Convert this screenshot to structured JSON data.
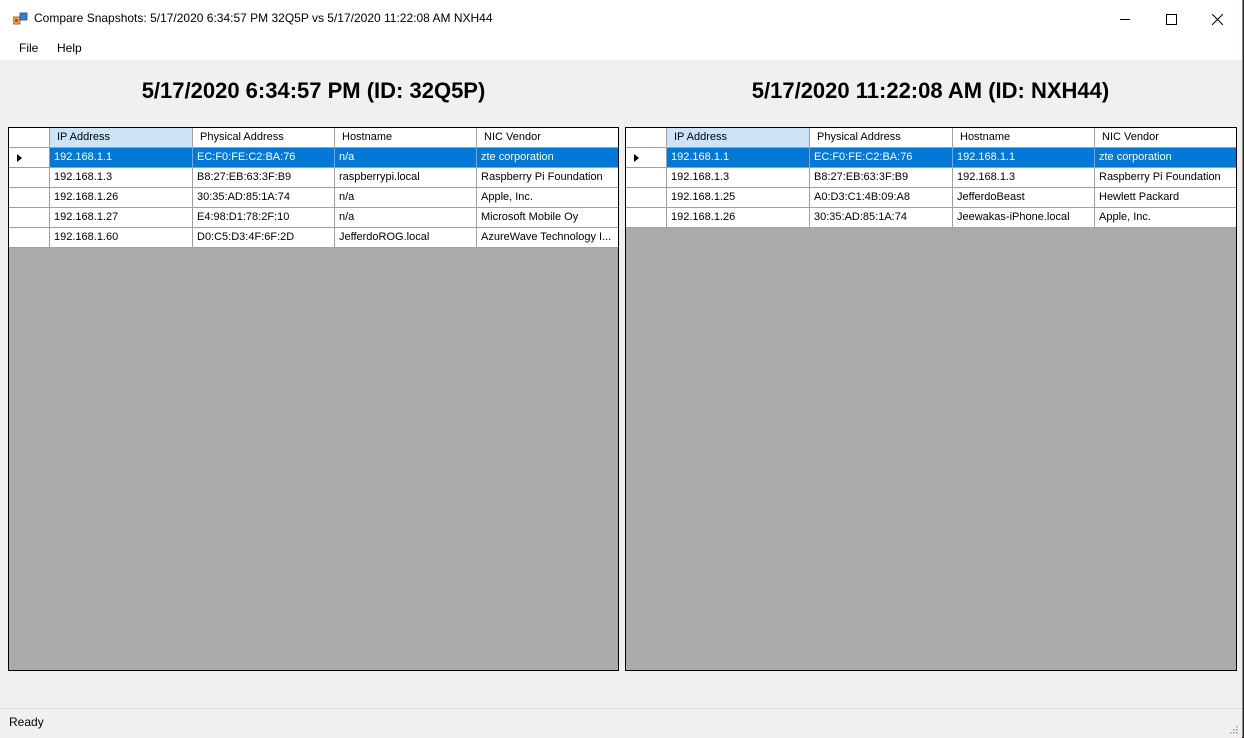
{
  "window": {
    "title": "Compare Snapshots: 5/17/2020 6:34:57 PM 32Q5P vs 5/17/2020 11:22:08 AM NXH44",
    "minimize_icon": "minimize-icon",
    "maximize_icon": "maximize-icon",
    "close_icon": "close-icon"
  },
  "menu": {
    "file": "File",
    "help": "Help"
  },
  "left": {
    "title": "5/17/2020 6:34:57 PM (ID: 32Q5P)",
    "columns": [
      "IP Address",
      "Physical Address",
      "Hostname",
      "NIC Vendor"
    ],
    "rows": [
      [
        "192.168.1.1",
        "EC:F0:FE:C2:BA:76",
        "n/a",
        "zte corporation"
      ],
      [
        "192.168.1.3",
        "B8:27:EB:63:3F:B9",
        "raspberrypi.local",
        "Raspberry Pi Foundation"
      ],
      [
        "192.168.1.26",
        "30:35:AD:85:1A:74",
        "n/a",
        "Apple, Inc."
      ],
      [
        "192.168.1.27",
        "E4:98:D1:78:2F:10",
        "n/a",
        "Microsoft Mobile Oy"
      ],
      [
        "192.168.1.60",
        "D0:C5:D3:4F:6F:2D",
        "JefferdoROG.local",
        "AzureWave Technology I..."
      ]
    ]
  },
  "right": {
    "title": "5/17/2020 11:22:08 AM (ID: NXH44)",
    "columns": [
      "IP Address",
      "Physical Address",
      "Hostname",
      "NIC Vendor"
    ],
    "rows": [
      [
        "192.168.1.1",
        "EC:F0:FE:C2:BA:76",
        "192.168.1.1",
        "zte corporation"
      ],
      [
        "192.168.1.3",
        "B8:27:EB:63:3F:B9",
        "192.168.1.3",
        "Raspberry Pi Foundation"
      ],
      [
        "192.168.1.25",
        "A0:D3:C1:4B:09:A8",
        "JefferdoBeast",
        "Hewlett Packard"
      ],
      [
        "192.168.1.26",
        "30:35:AD:85:1A:74",
        "Jeewakas-iPhone.local",
        "Apple, Inc."
      ]
    ]
  },
  "status": {
    "text": "Ready"
  },
  "colors": {
    "selection": "#0078d7",
    "header_highlight": "#cce4f7",
    "grid_background": "#ababab"
  }
}
